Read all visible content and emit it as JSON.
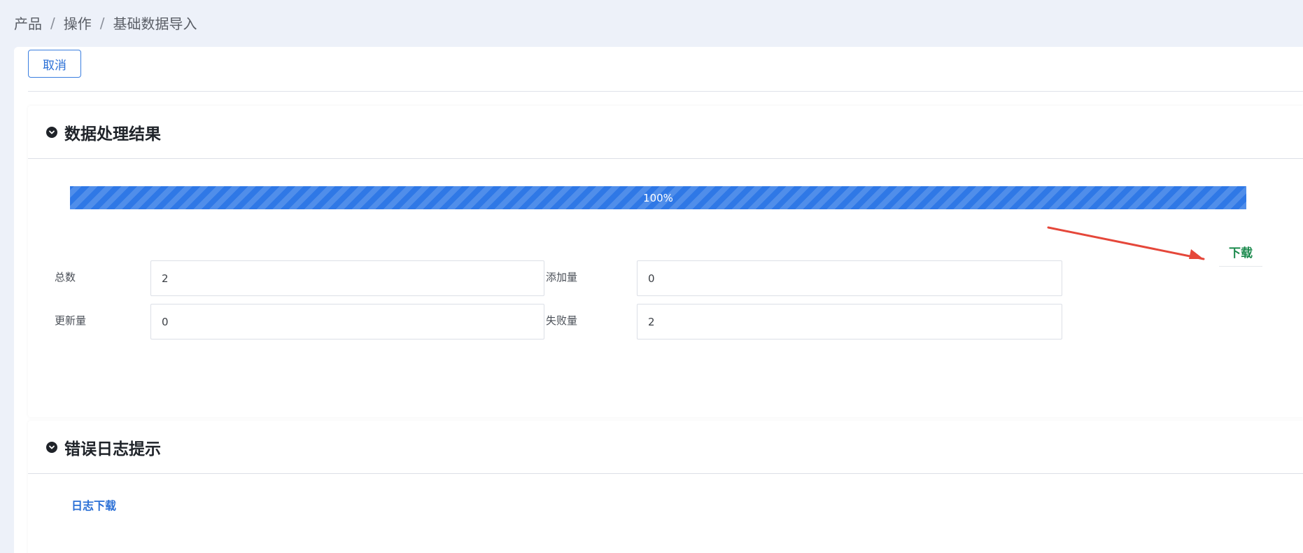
{
  "breadcrumb": {
    "items": [
      "产品",
      "操作",
      "基础数据导入"
    ],
    "separator": "/"
  },
  "toolbar": {
    "cancel_label": "取消"
  },
  "result_section": {
    "title": "数据处理结果",
    "progress": {
      "percent": 100,
      "label": "100%"
    },
    "download_label": "下载",
    "fields": {
      "total": {
        "label": "总数",
        "value": "2"
      },
      "added": {
        "label": "添加量",
        "value": "0"
      },
      "updated": {
        "label": "更新量",
        "value": "0"
      },
      "failed": {
        "label": "失败量",
        "value": "2"
      }
    }
  },
  "error_section": {
    "title": "错误日志提示",
    "log_download_label": "日志下载"
  },
  "icons": {
    "section_toggle": "chevron-down-circle-icon",
    "annotation": "red-arrow-annotation"
  },
  "colors": {
    "accent": "#2f78e6",
    "download_green": "#1b8a4d",
    "annotation_red": "#e5473a"
  }
}
